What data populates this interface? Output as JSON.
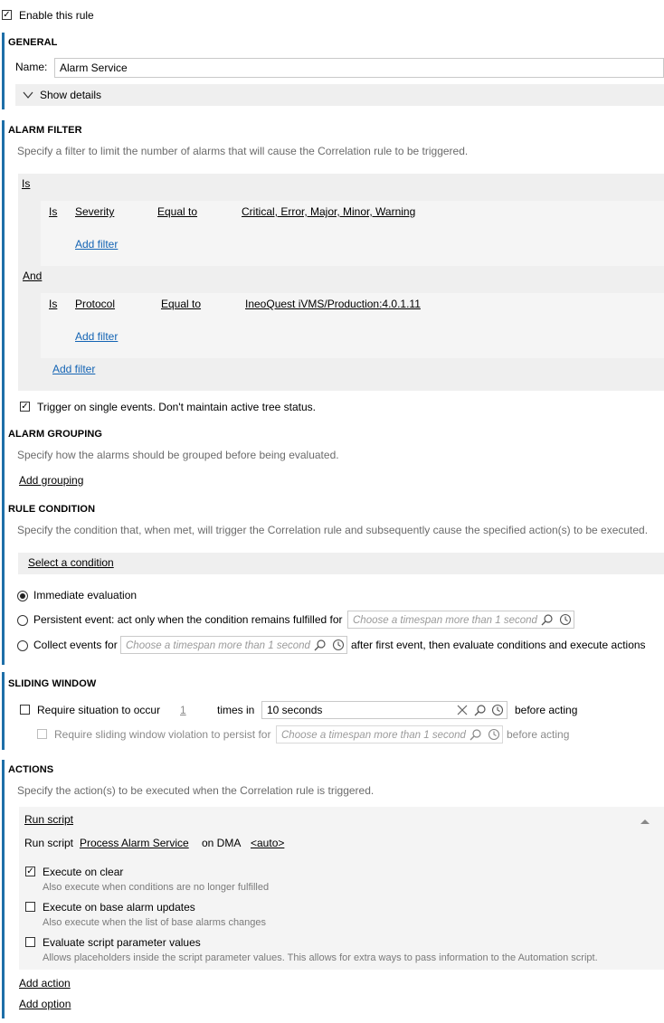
{
  "enable_rule": {
    "label": "Enable this rule",
    "checked": true
  },
  "general": {
    "heading": "GENERAL",
    "name_label": "Name:",
    "name_value": "Alarm Service",
    "show_details": "Show details"
  },
  "alarm_filter": {
    "heading": "ALARM FILTER",
    "description": "Specify a filter to limit the number of alarms that will cause the Correlation rule to be triggered.",
    "outer_is": "Is",
    "group1": {
      "is": "Is",
      "field": "Severity",
      "op": "Equal to",
      "value": "Critical, Error, Major, Minor, Warning",
      "add_filter": "Add filter"
    },
    "and_label": "And",
    "group2": {
      "is": "Is",
      "field": "Protocol",
      "op": "Equal to",
      "value": "IneoQuest iVMS/Production:4.0.1.11",
      "add_filter": "Add filter"
    },
    "add_filter": "Add filter",
    "trigger_single": {
      "label": "Trigger on single events. Don't maintain active tree status.",
      "checked": true
    }
  },
  "alarm_grouping": {
    "heading": "ALARM GROUPING",
    "description": "Specify how the alarms should be grouped before being evaluated.",
    "add_grouping": "Add grouping"
  },
  "rule_condition": {
    "heading": "RULE CONDITION",
    "description": "Specify the condition that, when met, will trigger the Correlation rule and subsequently cause the specified action(s) to be executed.",
    "select_condition": "Select a condition",
    "immediate": "Immediate evaluation",
    "persistent": "Persistent event: act only when the condition remains fulfilled for",
    "persistent_placeholder": "Choose a timespan more than 1 second",
    "collect": "Collect events for",
    "collect_placeholder": "Choose a timespan more than 1 second",
    "collect_suffix": "after first event, then evaluate conditions and execute actions",
    "selected": "immediate"
  },
  "sliding_window": {
    "heading": "SLIDING WINDOW",
    "require_situation": "Require situation to occur",
    "count": "1",
    "times_in": "times in",
    "window_value": "10 seconds",
    "before_acting": "before acting",
    "require_violation": "Require sliding window violation to persist for",
    "violation_placeholder": "Choose a timespan more than 1 second",
    "before_acting2": "before acting"
  },
  "actions": {
    "heading": "ACTIONS",
    "description": "Specify the action(s) to be executed when the Correlation rule is triggered.",
    "run_script_title": "Run script",
    "run_script_label": "Run script",
    "script_name": "Process Alarm Service",
    "on_dma": "on DMA",
    "dma_value": "<auto>",
    "execute_on_clear": {
      "label": "Execute on clear",
      "desc": "Also execute when conditions are no longer fulfilled",
      "checked": true
    },
    "execute_on_base": {
      "label": "Execute on base alarm updates",
      "desc": "Also execute when the list of base alarms changes",
      "checked": false
    },
    "evaluate_params": {
      "label": "Evaluate script parameter values",
      "desc": "Allows placeholders inside the script parameter values. This allows for extra ways to pass information to the Automation script.",
      "checked": false
    },
    "add_action": "Add action",
    "add_option": "Add option"
  },
  "icons": {
    "check": "check-icon",
    "chevron": "chevron-down-icon",
    "search": "search-icon",
    "clock": "clock-icon",
    "clear": "close-icon",
    "collapse": "chevron-up-icon"
  },
  "colors": {
    "accent": "#1e6fa8",
    "link": "#1464b4",
    "panel": "#efefef"
  }
}
